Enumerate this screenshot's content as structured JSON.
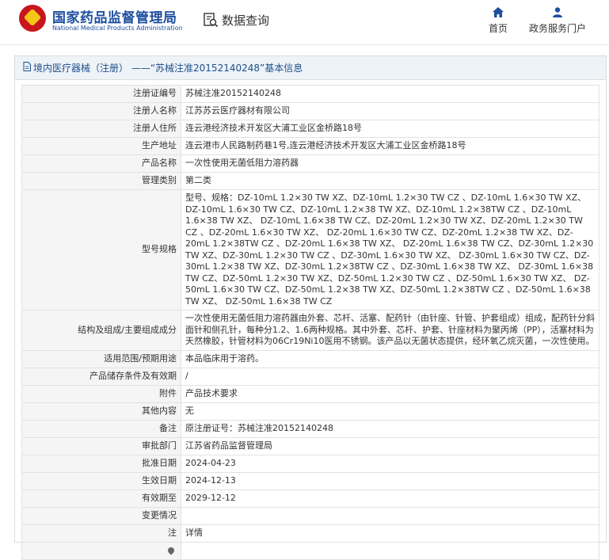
{
  "header": {
    "brand_cn": "国家药品监督管理局",
    "brand_en": "National Medical Products Administration",
    "search_label": "数据查询",
    "nav": {
      "home": "首页",
      "portal": "政务服务门户"
    }
  },
  "panel": {
    "title": "境内医疗器械（注册） ——“苏械注准20152140248”基本信息"
  },
  "rows": [
    {
      "label": "注册证编号",
      "value": "苏械注准20152140248"
    },
    {
      "label": "注册人名称",
      "value": "江苏苏云医疗器材有限公司"
    },
    {
      "label": "注册人住所",
      "value": "连云港经济技术开发区大浦工业区金桥路18号"
    },
    {
      "label": "生产地址",
      "value": "连云港市人民路制药巷1号,连云港经济技术开发区大浦工业区金桥路18号"
    },
    {
      "label": "产品名称",
      "value": "一次性使用无菌低阻力溶药器"
    },
    {
      "label": "管理类别",
      "value": "第二类"
    },
    {
      "label": "型号规格",
      "value": "型号、规格：DZ-10mL 1.2×30 TW XZ、DZ-10mL 1.2×30 TW CZ 、DZ-10mL 1.6×30 TW XZ、 DZ-10mL 1.6×30 TW CZ、DZ-10mL 1.2×38 TW XZ、DZ-10mL 1.2×38TW CZ 、DZ-10mL 1.6×38 TW XZ、 DZ-10mL 1.6×38 TW CZ、DZ-20mL 1.2×30 TW XZ、DZ-20mL 1.2×30 TW CZ 、DZ-20mL 1.6×30 TW XZ、 DZ-20mL 1.6×30 TW CZ、DZ-20mL 1.2×38 TW XZ、DZ-20mL 1.2×38TW CZ 、DZ-20mL 1.6×38 TW XZ、 DZ-20mL 1.6×38 TW CZ、DZ-30mL 1.2×30 TW XZ、DZ-30mL 1.2×30 TW CZ 、DZ-30mL 1.6×30 TW XZ、 DZ-30mL 1.6×30 TW CZ、DZ-30mL 1.2×38 TW XZ、DZ-30mL 1.2×38TW CZ 、DZ-30mL 1.6×38 TW XZ、 DZ-30mL 1.6×38 TW CZ、DZ-50mL 1.2×30 TW XZ、DZ-50mL 1.2×30 TW CZ 、DZ-50mL 1.6×30 TW XZ、 DZ-50mL 1.6×30 TW CZ、DZ-50mL 1.2×38 TW XZ、DZ-50mL 1.2×38TW CZ 、DZ-50mL 1.6×38 TW XZ、 DZ-50mL 1.6×38 TW CZ"
    },
    {
      "label": "结构及组成/主要组成成分",
      "value": "一次性使用无菌低阻力溶药器由外套、芯杆、活塞、配药针（由针座、针管、护套组成）组成，配药针分斜面针和侧孔针，每种分1.2、1.6两种规格。其中外套、芯杆、护套、针座材料为聚丙烯（PP），活塞材料为天然橡胶，针管材料为06Cr19Ni10医用不锈钢。该产品以无菌状态提供，经环氧乙烷灭菌，一次性使用。"
    },
    {
      "label": "适用范围/预期用途",
      "value": "本品临床用于溶药。"
    },
    {
      "label": "产品储存条件及有效期",
      "value": "/"
    },
    {
      "label": "附件",
      "value": "产品技术要求"
    },
    {
      "label": "其他内容",
      "value": "无"
    },
    {
      "label": "备注",
      "value": "原注册证号：苏械注准20152140248"
    },
    {
      "label": "审批部门",
      "value": "江苏省药品监督管理局"
    },
    {
      "label": "批准日期",
      "value": "2024-04-23"
    },
    {
      "label": "生效日期",
      "value": "2024-12-13"
    },
    {
      "label": "有效期至",
      "value": "2029-12-12"
    },
    {
      "label": "变更情况",
      "value": ""
    },
    {
      "label": "注",
      "value": "详情"
    }
  ]
}
